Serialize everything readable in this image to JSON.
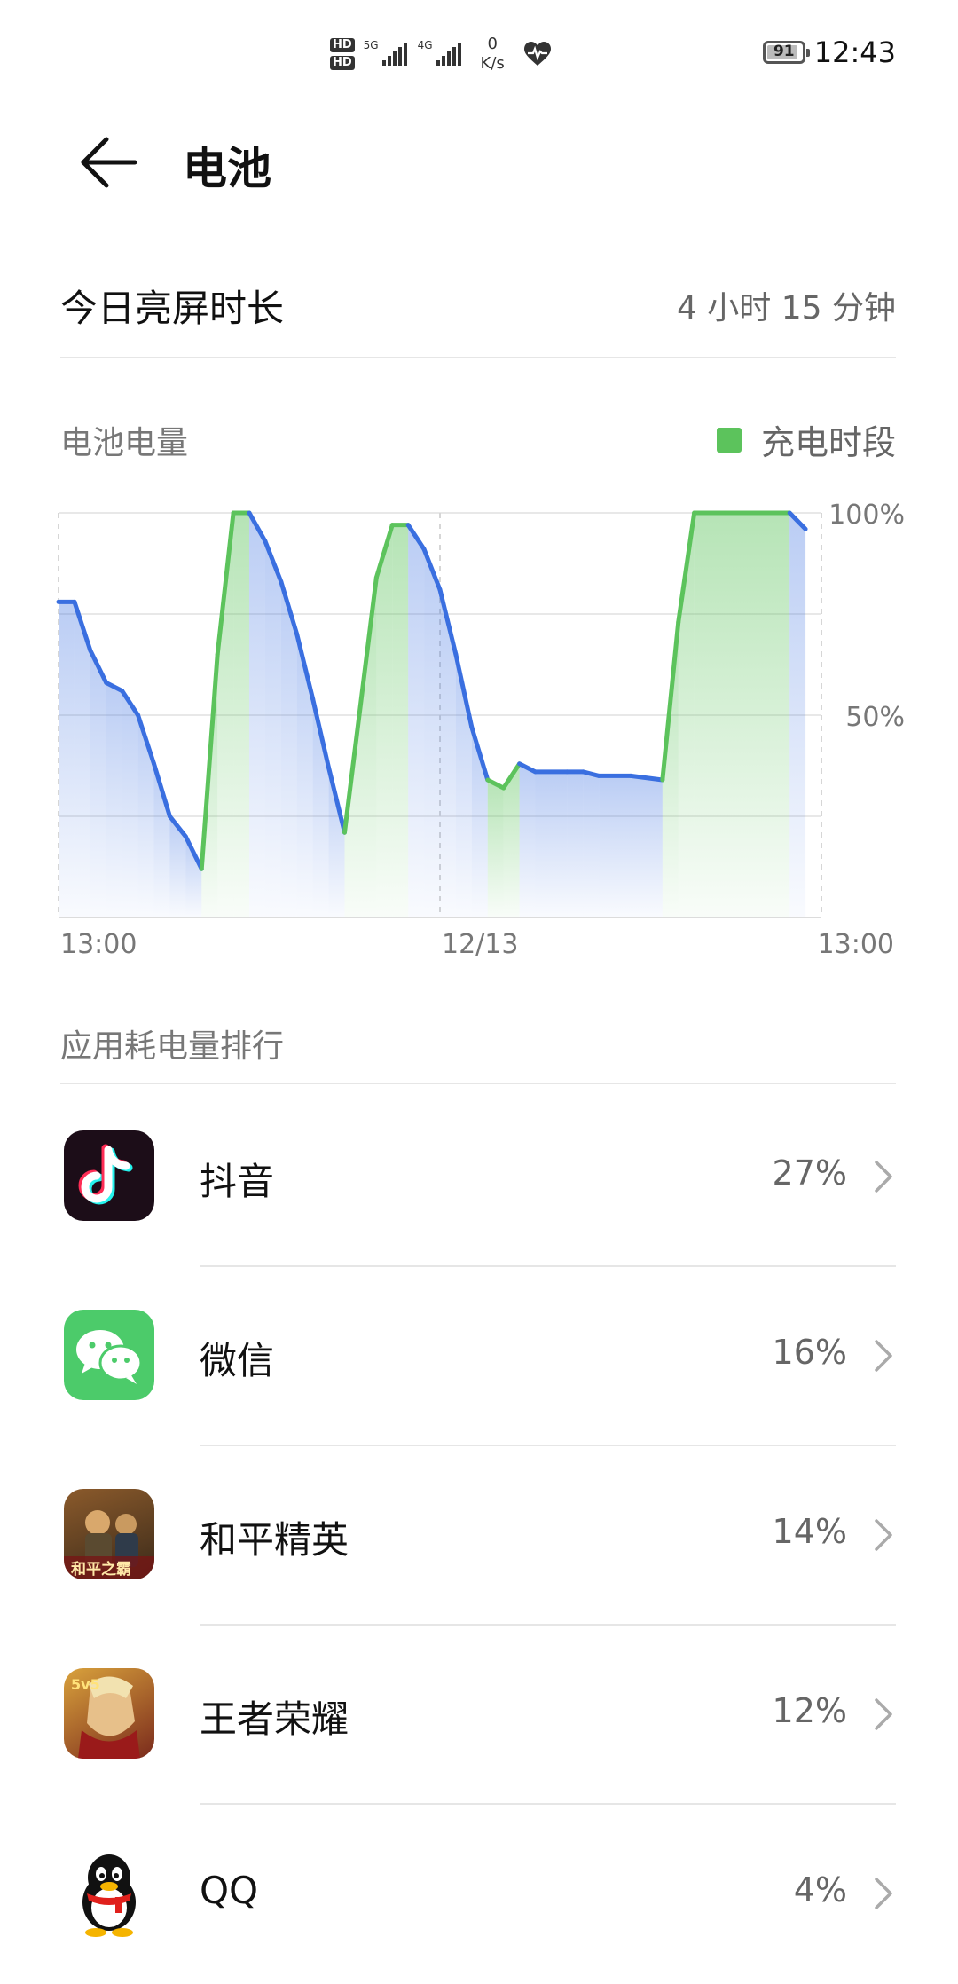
{
  "status_bar": {
    "sim1": "HD",
    "sim2": "HD",
    "net1": "5G",
    "net2": "4G",
    "speed_value": "0",
    "speed_unit": "K/s",
    "battery_level": "91",
    "time": "12:43"
  },
  "header": {
    "title": "电池"
  },
  "screen_time": {
    "label": "今日亮屏时长",
    "value": "4 小时 15 分钟"
  },
  "chart_section": {
    "title": "电池电量",
    "legend_label": "充电时段"
  },
  "chart_data": {
    "type": "area",
    "title": "电池电量",
    "x_tick_labels": [
      "13:00",
      "12/13",
      "13:00"
    ],
    "y_tick_labels": [
      "100%",
      "50%"
    ],
    "ylim": [
      0,
      100
    ],
    "xlim": [
      0,
      24
    ],
    "grid": true,
    "legend": [
      {
        "name": "充电时段",
        "color": "#5cc35c",
        "position": "top-right"
      }
    ],
    "colors": {
      "discharge": "#3a6fe0",
      "charging": "#5cc35c"
    },
    "points": [
      {
        "x": 0.0,
        "y": 78,
        "c": false
      },
      {
        "x": 0.5,
        "y": 78,
        "c": false
      },
      {
        "x": 1.0,
        "y": 66,
        "c": false
      },
      {
        "x": 1.5,
        "y": 58,
        "c": false
      },
      {
        "x": 2.0,
        "y": 56,
        "c": false
      },
      {
        "x": 2.5,
        "y": 50,
        "c": false
      },
      {
        "x": 3.0,
        "y": 38,
        "c": false
      },
      {
        "x": 3.5,
        "y": 25,
        "c": false
      },
      {
        "x": 4.0,
        "y": 20,
        "c": false
      },
      {
        "x": 4.5,
        "y": 12,
        "c": true
      },
      {
        "x": 5.0,
        "y": 65,
        "c": true
      },
      {
        "x": 5.5,
        "y": 100,
        "c": true
      },
      {
        "x": 6.0,
        "y": 100,
        "c": false
      },
      {
        "x": 6.5,
        "y": 93,
        "c": false
      },
      {
        "x": 7.0,
        "y": 83,
        "c": false
      },
      {
        "x": 7.5,
        "y": 70,
        "c": false
      },
      {
        "x": 8.0,
        "y": 54,
        "c": false
      },
      {
        "x": 8.5,
        "y": 37,
        "c": false
      },
      {
        "x": 9.0,
        "y": 21,
        "c": true
      },
      {
        "x": 10.0,
        "y": 84,
        "c": true
      },
      {
        "x": 10.5,
        "y": 97,
        "c": true
      },
      {
        "x": 11.0,
        "y": 97,
        "c": false
      },
      {
        "x": 11.5,
        "y": 91,
        "c": false
      },
      {
        "x": 12.0,
        "y": 81,
        "c": false
      },
      {
        "x": 12.5,
        "y": 65,
        "c": false
      },
      {
        "x": 13.0,
        "y": 47,
        "c": false
      },
      {
        "x": 13.5,
        "y": 34,
        "c": true
      },
      {
        "x": 14.0,
        "y": 32,
        "c": true
      },
      {
        "x": 14.5,
        "y": 38,
        "c": false
      },
      {
        "x": 15.0,
        "y": 36,
        "c": false
      },
      {
        "x": 16.0,
        "y": 36,
        "c": false
      },
      {
        "x": 16.5,
        "y": 36,
        "c": false
      },
      {
        "x": 17.0,
        "y": 35,
        "c": false
      },
      {
        "x": 18.0,
        "y": 35,
        "c": false
      },
      {
        "x": 19.0,
        "y": 34,
        "c": true
      },
      {
        "x": 19.5,
        "y": 73,
        "c": true
      },
      {
        "x": 20.0,
        "y": 100,
        "c": true
      },
      {
        "x": 21.0,
        "y": 100,
        "c": true
      },
      {
        "x": 23.0,
        "y": 100,
        "c": false
      },
      {
        "x": 23.5,
        "y": 96,
        "c": false
      }
    ]
  },
  "ranking": {
    "title": "应用耗电量排行",
    "apps": [
      {
        "name": "抖音",
        "percent": "27%",
        "icon": "douyin-icon"
      },
      {
        "name": "微信",
        "percent": "16%",
        "icon": "wechat-icon"
      },
      {
        "name": "和平精英",
        "percent": "14%",
        "icon": "peace-elite-icon",
        "icon_text": "和平之霸"
      },
      {
        "name": "王者荣耀",
        "percent": "12%",
        "icon": "honor-of-kings-icon",
        "icon_text": "5v5"
      },
      {
        "name": "QQ",
        "percent": "4%",
        "icon": "qq-icon"
      }
    ]
  }
}
